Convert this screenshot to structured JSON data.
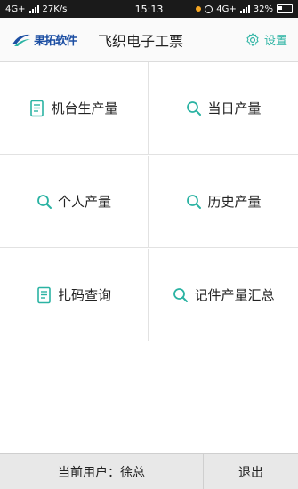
{
  "status_bar": {
    "network": "4G+",
    "speed": "27K/s",
    "time": "15:13",
    "network_right": "4G+",
    "battery": "32%"
  },
  "header": {
    "logo_text": "果拓软件",
    "title": "飞织电子工票",
    "settings_label": "设置"
  },
  "menu": [
    {
      "label": "机台生产量",
      "icon": "document-icon"
    },
    {
      "label": "当日产量",
      "icon": "search-icon"
    },
    {
      "label": "个人产量",
      "icon": "search-icon"
    },
    {
      "label": "历史产量",
      "icon": "search-icon"
    },
    {
      "label": "扎码查询",
      "icon": "document-icon"
    },
    {
      "label": "记件产量汇总",
      "icon": "search-icon"
    }
  ],
  "footer": {
    "user_prefix": "当前用户：",
    "user_name": "徐总",
    "logout_label": "退出"
  },
  "colors": {
    "accent": "#2bb3a3",
    "logo_blue": "#1d4fa3"
  }
}
